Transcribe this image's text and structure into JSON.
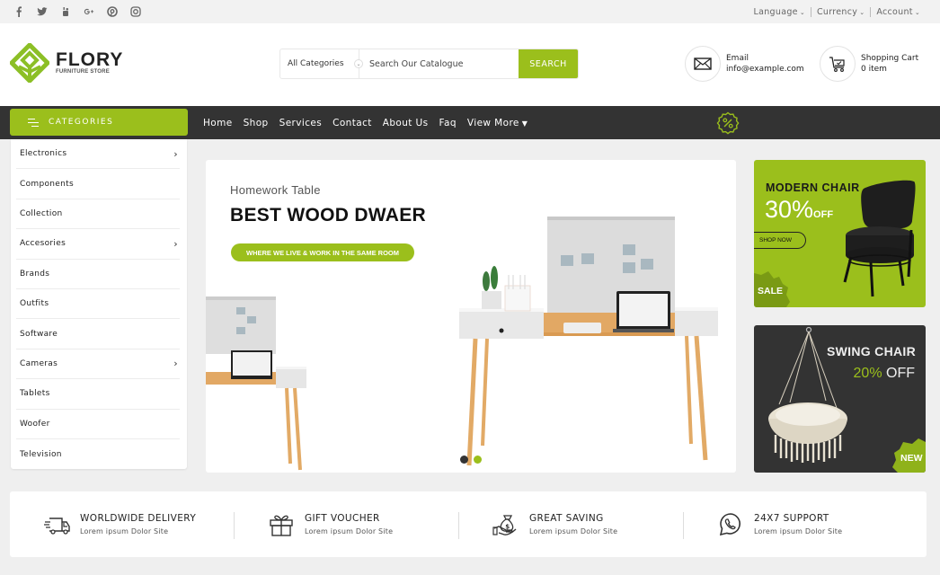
{
  "colors": {
    "accent": "#9bbf1c",
    "dark": "#333333",
    "background": "#efefef"
  },
  "topbar": {
    "socials": [
      {
        "name": "facebook-icon",
        "glyph": "f"
      },
      {
        "name": "twitter-icon",
        "glyph": "t"
      },
      {
        "name": "youtube-icon",
        "glyph": "y"
      },
      {
        "name": "google-plus-icon",
        "glyph": "G+"
      },
      {
        "name": "pinterest-icon",
        "glyph": "p"
      },
      {
        "name": "instagram-icon",
        "glyph": "i"
      }
    ],
    "links": [
      {
        "label": "Language",
        "icon": "chevron-down-icon"
      },
      {
        "label": "Currency",
        "icon": "chevron-down-icon"
      },
      {
        "label": "Account",
        "icon": "chevron-down-icon"
      }
    ]
  },
  "header": {
    "brand": "FLORY",
    "tagline": "FURNITURE STORE",
    "search": {
      "category": "All Categories",
      "placeholder": "Search Our Catalogue",
      "button": "SEARCH"
    },
    "email": {
      "label": "Email",
      "value": "info@example.com"
    },
    "cart": {
      "label": "Shopping Cart",
      "value": "0 item"
    }
  },
  "nav": {
    "categories_label": "CATEGORIES",
    "links": [
      "Home",
      "Shop",
      "Services",
      "Contact",
      "About Us",
      "Faq",
      "View More"
    ]
  },
  "categories": [
    {
      "label": "Electronics",
      "has_sub": true
    },
    {
      "label": "Components",
      "has_sub": false
    },
    {
      "label": "Collection",
      "has_sub": false
    },
    {
      "label": "Accesories",
      "has_sub": true
    },
    {
      "label": "Brands",
      "has_sub": false
    },
    {
      "label": "Outfits",
      "has_sub": false
    },
    {
      "label": "Software",
      "has_sub": false
    },
    {
      "label": "Cameras",
      "has_sub": true
    },
    {
      "label": "Tablets",
      "has_sub": false
    },
    {
      "label": "Woofer",
      "has_sub": false
    },
    {
      "label": "Television",
      "has_sub": false
    }
  ],
  "hero": {
    "pretitle": "Homework Table",
    "title": "BEST WOOD DWAER",
    "pill": "WHERE WE LIVE & WORK IN THE SAME ROOM",
    "slides": 2,
    "active_slide": 2
  },
  "banners": {
    "modern": {
      "title": "MODERN CHAIR",
      "percent": "30%",
      "off": "OFF",
      "cta": "SHOP NOW",
      "badge": "SALE"
    },
    "swing": {
      "title": "SWING CHAIR",
      "percent": "20%",
      "off": "OFF",
      "badge": "NEW"
    }
  },
  "features": [
    {
      "icon": "delivery-truck-icon",
      "title": "WORLDWIDE DELIVERY",
      "sub": "Lorem ipsum Dolor Site"
    },
    {
      "icon": "gift-icon",
      "title": "GIFT VOUCHER",
      "sub": "Lorem ipsum Dolor Site"
    },
    {
      "icon": "money-bag-icon",
      "title": "GREAT SAVING",
      "sub": "Lorem ipsum Dolor Site"
    },
    {
      "icon": "whatsapp-icon",
      "title": "24X7 SUPPORT",
      "sub": "Lorem ipsum Dolor Site"
    }
  ]
}
